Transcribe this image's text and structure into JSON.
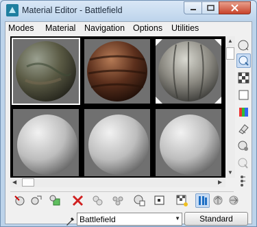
{
  "window": {
    "title": "Material Editor - Battlefield"
  },
  "menu": {
    "items": [
      "Modes",
      "Material",
      "Navigation",
      "Options",
      "Utilities"
    ]
  },
  "slots": [
    {
      "material": "rocky ground",
      "active": true
    },
    {
      "material": "rusted metal",
      "active": false
    },
    {
      "material": "wood planks",
      "active": false
    },
    {
      "material": "default gray",
      "active": false
    },
    {
      "material": "default gray",
      "active": false
    },
    {
      "material": "default gray",
      "active": false
    }
  ],
  "side_tools": [
    "sample-type-icon",
    "backlight-icon",
    "background-icon",
    "uv-tiling-icon",
    "video-color-check-icon",
    "make-preview-icon",
    "options-icon",
    "select-by-material-icon",
    "material-map-navigator-icon"
  ],
  "bottom_tools": [
    "get-material-icon",
    "put-to-scene-icon",
    "assign-to-selection-icon",
    "reset-map-icon",
    "make-unique-icon",
    "put-to-library-icon",
    "material-id-channel-icon",
    "show-shaded-material-icon",
    "show-end-result-icon",
    "go-to-parent-icon",
    "go-forward-icon"
  ],
  "material_name": "Battlefield",
  "material_type": "Standard",
  "colors": {
    "accent": "#3a7fd1",
    "close_button": "#c8432b"
  }
}
